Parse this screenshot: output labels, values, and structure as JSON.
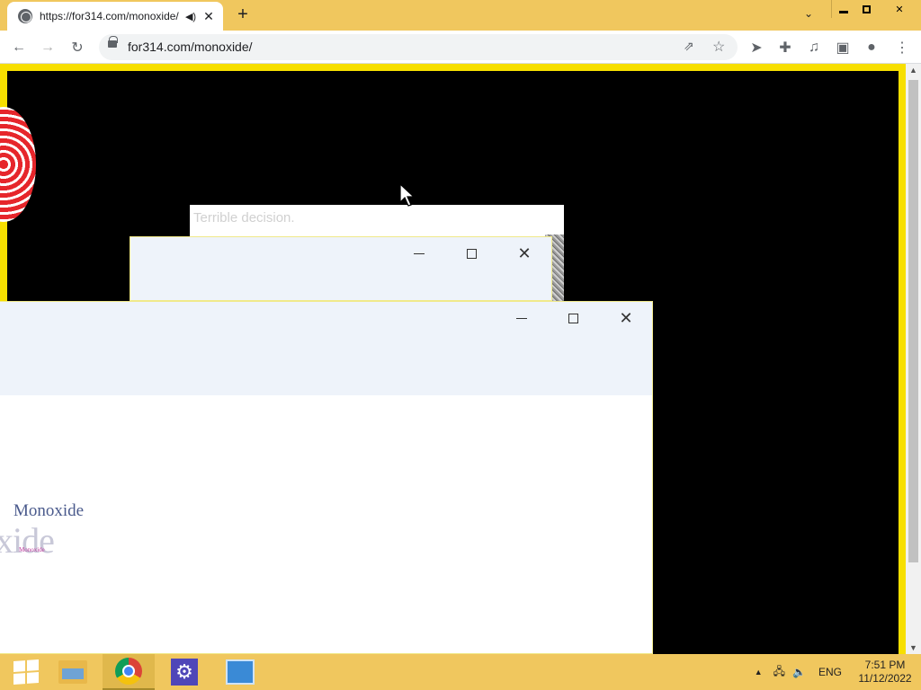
{
  "browser": {
    "tab": {
      "title": "https://for314.com/monoxide/",
      "audio_icon": "speaker-icon",
      "close_icon": "close-icon"
    },
    "new_tab_icon": "plus-icon",
    "address": "for314.com/monoxide/",
    "toolbar_icons": [
      "back-icon",
      "forward-icon",
      "reload-icon",
      "lock-icon",
      "share-icon",
      "star-icon",
      "cast-icon",
      "extensions-icon",
      "media-icon",
      "sidepanel-icon",
      "profile-icon",
      "menu-icon"
    ]
  },
  "page": {
    "message_text": "Terrible decision.",
    "monoxide_text": "Monoxide",
    "large_text": "xide",
    "tiny_text": "Monoxide"
  },
  "dialogs": [
    {
      "controls": [
        "minimize",
        "maximize",
        "close"
      ]
    },
    {
      "controls": [
        "minimize",
        "maximize",
        "close"
      ]
    }
  ],
  "taskbar": {
    "items": [
      "start-icon",
      "file-explorer-icon",
      "chrome-icon",
      "settings-icon",
      "control-panel-icon"
    ],
    "tray": {
      "language": "ENG",
      "time": "7:51 PM",
      "date": "11/12/2022"
    }
  },
  "colors": {
    "title_bar": "#f0c75e",
    "page_border": "#f7df00",
    "page_bg": "#000000",
    "dialog_bg": "#eef3fa"
  }
}
